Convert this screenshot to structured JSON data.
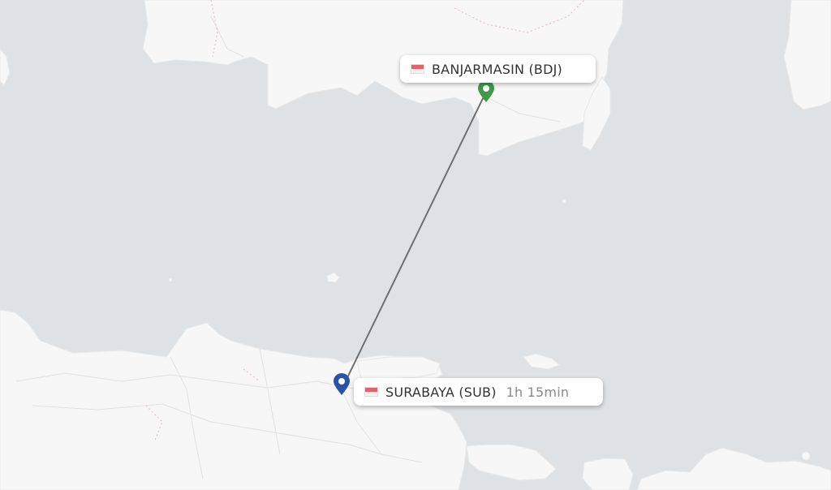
{
  "origin": {
    "city": "BANJARMASIN",
    "code": "BDJ",
    "label": "BANJARMASIN (BDJ)",
    "flag": "indonesia-flag",
    "marker_color": "#3c9a4a"
  },
  "destination": {
    "city": "SURABAYA",
    "code": "SUB",
    "label": "SURABAYA (SUB)",
    "flag": "indonesia-flag",
    "marker_color": "#2a52a8"
  },
  "flight": {
    "duration": "1h 15min"
  },
  "colors": {
    "sea": "#dfe2e4",
    "land": "#f7f7f7",
    "route": "#6f6f6f"
  }
}
